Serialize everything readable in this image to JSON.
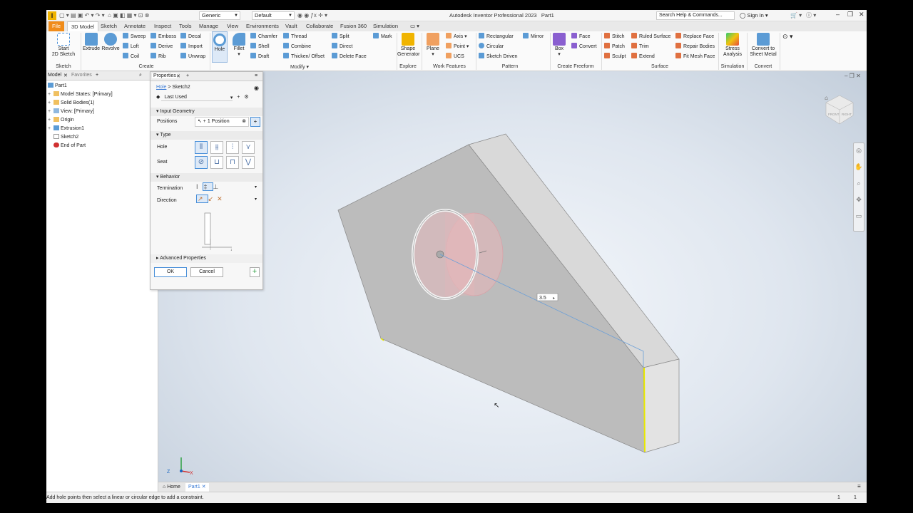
{
  "titlebar": {
    "app_title": "Autodesk Inventor Professional 2023",
    "doc_name": "Part1",
    "material": "Generic",
    "appearance": "Default",
    "search_placeholder": "Search Help & Commands...",
    "sign_in": "Sign In"
  },
  "tabs": [
    "File",
    "3D Model",
    "Sketch",
    "Annotate",
    "Inspect",
    "Tools",
    "Manage",
    "View",
    "Environments",
    "Vault",
    "Collaborate",
    "Fusion 360",
    "Simulation"
  ],
  "ribbon": {
    "sketch": {
      "start": "Start",
      "start2": "2D Sketch",
      "label": "Sketch"
    },
    "create": {
      "extrude": "Extrude",
      "revolve": "Revolve",
      "sweep": "Sweep",
      "loft": "Loft",
      "coil": "Coil",
      "emboss": "Emboss",
      "derive": "Derive",
      "rib": "Rib",
      "decal": "Decal",
      "import": "Import",
      "unwrap": "Unwrap",
      "label": "Create"
    },
    "modify": {
      "hole": "Hole",
      "fillet": "Fillet",
      "chamfer": "Chamfer",
      "shell": "Shell",
      "draft": "Draft",
      "thread": "Thread",
      "combine": "Combine",
      "thicken": "Thicken/ Offset",
      "split": "Split",
      "direct": "Direct",
      "delete_face": "Delete Face",
      "mark": "Mark",
      "label": "Modify"
    },
    "explore": {
      "shape1": "Shape",
      "shape2": "Generator",
      "label": "Explore"
    },
    "work": {
      "plane": "Plane",
      "axis": "Axis",
      "point": "Point",
      "ucs": "UCS",
      "label": "Work Features"
    },
    "pattern": {
      "rectangular": "Rectangular",
      "circular": "Circular",
      "sketch_driven": "Sketch Driven",
      "mirror": "Mirror",
      "label": "Pattern"
    },
    "freeform": {
      "box": "Box",
      "face": "Face",
      "convert": "Convert",
      "label": "Create Freeform"
    },
    "surface": {
      "stitch": "Stitch",
      "patch": "Patch",
      "sculpt": "Sculpt",
      "ruled": "Ruled Surface",
      "trim": "Trim",
      "extend": "Extend",
      "replace": "Replace Face",
      "repair": "Repair Bodies",
      "fitmesh": "Fit Mesh Face",
      "label": "Surface"
    },
    "simulation": {
      "stress1": "Stress",
      "stress2": "Analysis",
      "label": "Simulation"
    },
    "convert": {
      "c1": "Convert to",
      "c2": "Sheet Metal",
      "label": "Convert"
    }
  },
  "model_panel": {
    "tab_model": "Model",
    "tab_favorites": "Favorites",
    "tree": [
      "Part1",
      "Model States: [Primary]",
      "Solid Bodies(1)",
      "View: [Primary]",
      "Origin",
      "Extrusion1",
      "Sketch2",
      "End of Part"
    ]
  },
  "properties": {
    "tab": "Properties",
    "crumb_hole": "Hole",
    "crumb_sketch": "Sketch2",
    "preset": "Last Used",
    "input_geometry": "Input Geometry",
    "positions_label": "Positions",
    "positions_value": "1 Position",
    "type_label": "Type",
    "hole_label": "Hole",
    "seat_label": "Seat",
    "behavior_label": "Behavior",
    "termination_label": "Termination",
    "direction_label": "Direction",
    "advanced": "Advanced Properties",
    "ok": "OK",
    "cancel": "Cancel"
  },
  "viewport": {
    "dimension": "3.5",
    "viewcube_front": "FRONT",
    "viewcube_right": "RIGHT"
  },
  "doc_tabs": {
    "home": "Home",
    "part": "Part1"
  },
  "status": {
    "message": "Add hole points then select a linear or circular edge to add a constraint.",
    "n1": "1",
    "n2": "1"
  },
  "colors": {
    "accent": "#3a7bd5",
    "file_tab": "#f08c1a",
    "hole_preview": "#e8b4b8"
  }
}
